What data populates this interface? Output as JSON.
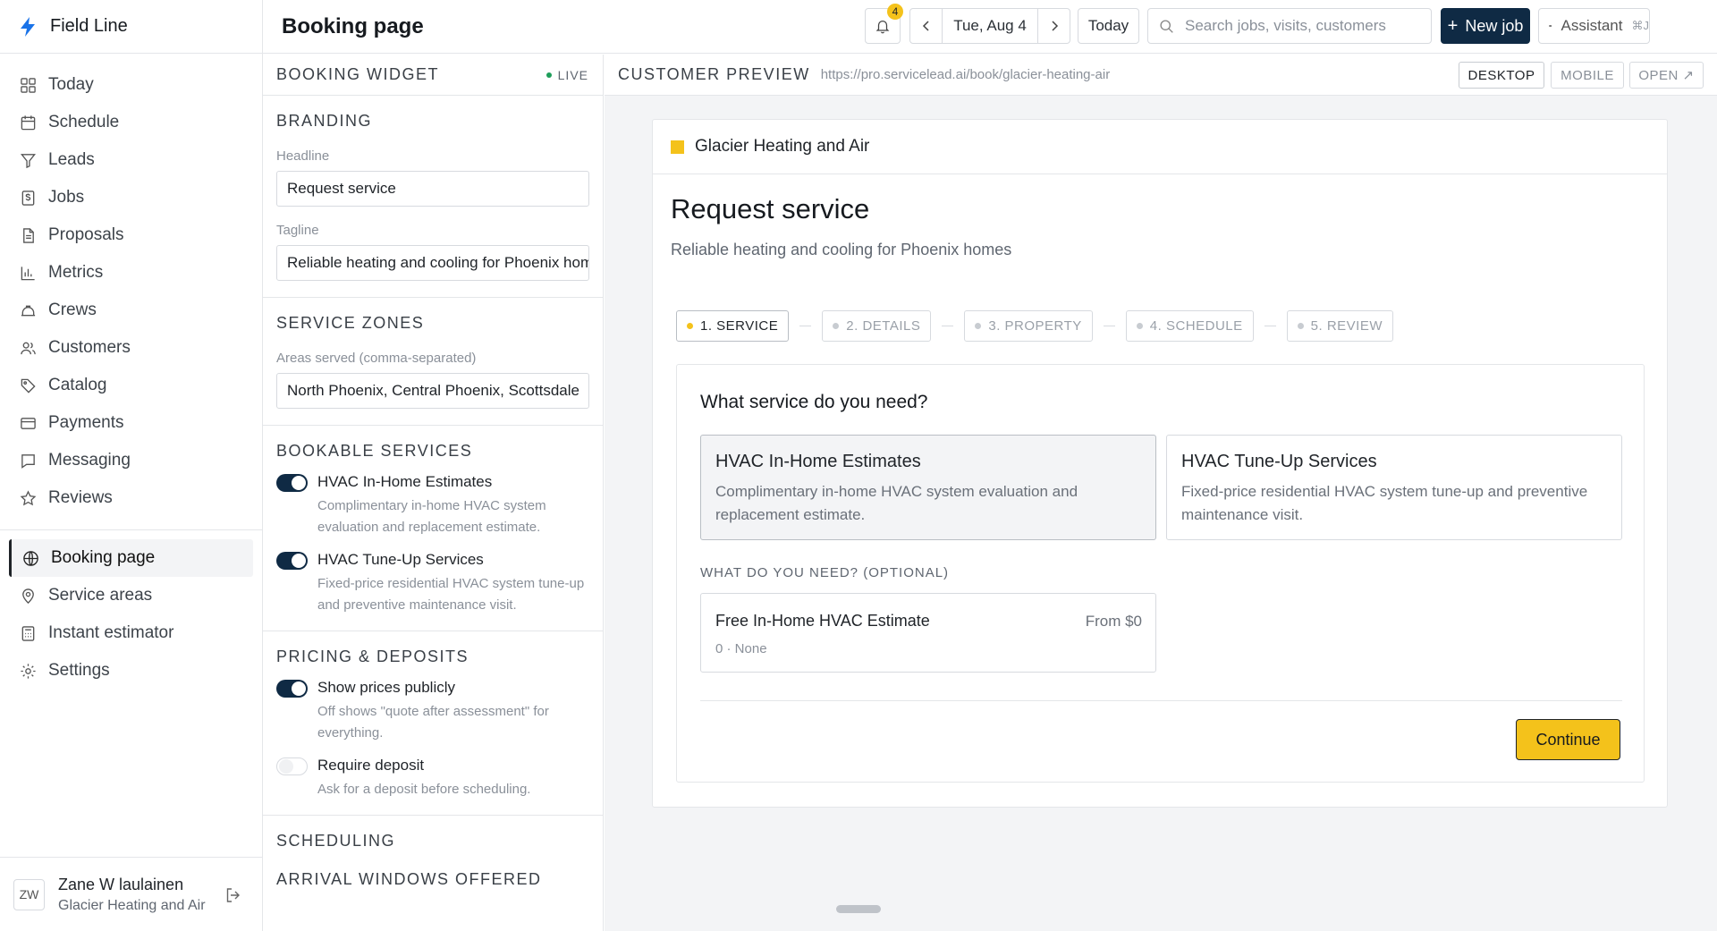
{
  "brand": {
    "name": "Field Line"
  },
  "nav": {
    "items": [
      {
        "label": "Today",
        "icon": "grid-icon"
      },
      {
        "label": "Schedule",
        "icon": "calendar-icon"
      },
      {
        "label": "Leads",
        "icon": "funnel-icon"
      },
      {
        "label": "Jobs",
        "icon": "dollar-doc-icon"
      },
      {
        "label": "Proposals",
        "icon": "document-icon"
      },
      {
        "label": "Metrics",
        "icon": "bar-chart-icon"
      },
      {
        "label": "Crews",
        "icon": "hardhat-icon"
      },
      {
        "label": "Customers",
        "icon": "users-icon"
      },
      {
        "label": "Catalog",
        "icon": "tag-icon"
      },
      {
        "label": "Payments",
        "icon": "credit-card-icon"
      },
      {
        "label": "Messaging",
        "icon": "chat-icon"
      },
      {
        "label": "Reviews",
        "icon": "star-icon"
      }
    ],
    "secondary": [
      {
        "label": "Booking page",
        "icon": "globe-icon",
        "active": true
      },
      {
        "label": "Service areas",
        "icon": "map-pin-icon"
      },
      {
        "label": "Instant estimator",
        "icon": "calculator-icon"
      },
      {
        "label": "Settings",
        "icon": "gear-icon"
      }
    ]
  },
  "user": {
    "initials": "ZW",
    "name": "Zane W laulainen",
    "org": "Glacier Heating and Air"
  },
  "topbar": {
    "title": "Booking page",
    "notifications": "4",
    "date": "Tue, Aug 4",
    "today": "Today",
    "search_placeholder": "Search jobs, visits, customers",
    "new_job": "New job",
    "assistant": "Assistant",
    "assistant_kbd": "⌘J"
  },
  "config": {
    "title": "BOOKING WIDGET",
    "status": "LIVE",
    "branding": {
      "title": "BRANDING",
      "headline_label": "Headline",
      "headline_value": "Request service",
      "tagline_label": "Tagline",
      "tagline_value": "Reliable heating and cooling for Phoenix homes"
    },
    "zones": {
      "title": "SERVICE ZONES",
      "label": "Areas served (comma-separated)",
      "value": "North Phoenix, Central Phoenix, Scottsdale"
    },
    "services": {
      "title": "BOOKABLE SERVICES",
      "items": [
        {
          "title": "HVAC In-Home Estimates",
          "desc": "Complimentary in-home HVAC system evaluation and replacement estimate.",
          "on": true
        },
        {
          "title": "HVAC Tune-Up Services",
          "desc": "Fixed-price residential HVAC system tune-up and preventive maintenance visit.",
          "on": true
        }
      ]
    },
    "pricing": {
      "title": "PRICING & DEPOSITS",
      "items": [
        {
          "title": "Show prices publicly",
          "desc": "Off shows \"quote after assessment\" for everything.",
          "on": true
        },
        {
          "title": "Require deposit",
          "desc": "Ask for a deposit before scheduling.",
          "on": false
        }
      ]
    },
    "scheduling": {
      "title": "SCHEDULING",
      "subtitle": "ARRIVAL WINDOWS OFFERED"
    }
  },
  "preview": {
    "title": "CUSTOMER PREVIEW",
    "url": "https://pro.servicelead.ai/book/glacier-heating-air",
    "desktop": "DESKTOP",
    "mobile": "MOBILE",
    "open": "OPEN ↗",
    "business": "Glacier Heating and Air",
    "headline": "Request service",
    "tagline": "Reliable heating and cooling for Phoenix homes",
    "steps": [
      "1. SERVICE",
      "2. DETAILS",
      "3. PROPERTY",
      "4. SCHEDULE",
      "5. REVIEW"
    ],
    "question": "What service do you need?",
    "services": [
      {
        "title": "HVAC In-Home Estimates",
        "desc": "Complimentary in-home HVAC system evaluation and replacement estimate."
      },
      {
        "title": "HVAC Tune-Up Services",
        "desc": "Fixed-price residential HVAC system tune-up and preventive maintenance visit."
      }
    ],
    "optional_label": "WHAT DO YOU NEED? (OPTIONAL)",
    "option": {
      "name": "Free In-Home HVAC Estimate",
      "price": "From $0",
      "sub": "0 · None"
    },
    "continue": "Continue"
  },
  "colors": {
    "accent": "#f4c21b",
    "primary": "#0f2a44",
    "live": "#1e9e5a"
  }
}
